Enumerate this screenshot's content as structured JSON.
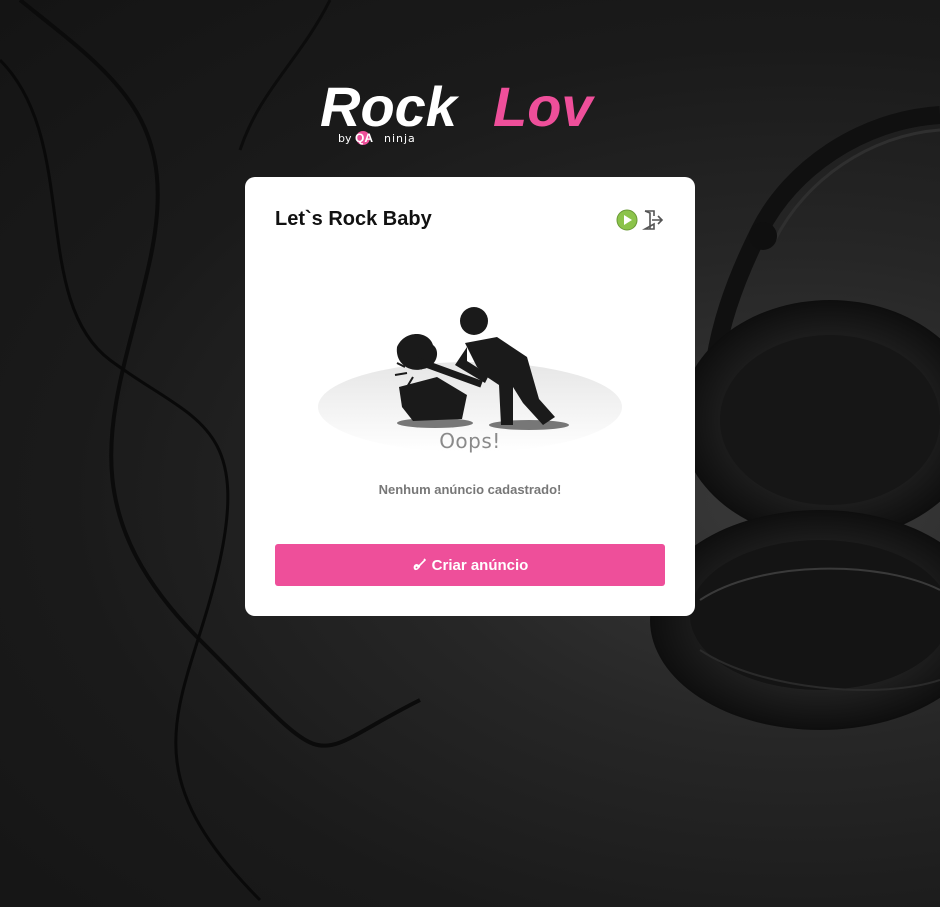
{
  "brand": {
    "name_part1": "Rock",
    "name_part2": "Lov",
    "byline_prefix": "by",
    "byline_qa": "QA",
    "byline_ninja": "ninja",
    "accent": "#ee4f9a"
  },
  "card": {
    "title": "Let`s Rock Baby",
    "play_icon": "play-circle-icon",
    "logout_icon": "logout-icon",
    "play_color": "#8bc34a"
  },
  "empty_state": {
    "oops": "Oops!",
    "message": "Nenhum anúncio cadastrado!"
  },
  "create_button": {
    "icon": "guitar-icon",
    "label": "Criar anúncio"
  }
}
